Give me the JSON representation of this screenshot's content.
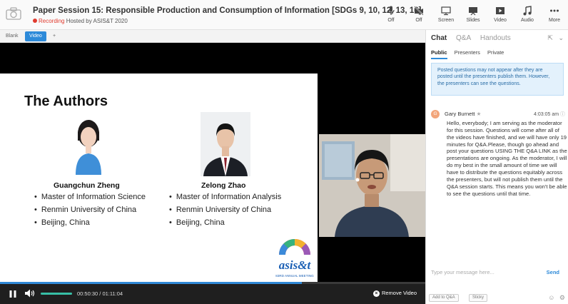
{
  "header": {
    "title": "Paper Session 15: Responsible Production and Consumption of Information [SDGs 9, 10, 12, 13, 16]",
    "recording_label": "Recording",
    "hosted_by": "Hosted by ASIS&T 2020"
  },
  "toolbar": {
    "mic_label": "Off",
    "camera_label": "Off",
    "screen_label": "Screen",
    "slides_label": "Slides",
    "video_label": "Video",
    "audio_label": "Audio",
    "more_label": "More"
  },
  "stage_tabs": {
    "blank_label": "Blank",
    "video_label": "Video",
    "add_label": "+"
  },
  "slide": {
    "title": "The Authors",
    "author1": {
      "name": "Guangchun Zheng",
      "items": [
        "Master of Information Science",
        "Renmin University of China",
        "Beijing, China"
      ]
    },
    "author2": {
      "name": "Zelong Zhao",
      "items": [
        "Master of Information Analysis",
        "Renmin University of China",
        "Beijing, China"
      ]
    },
    "logo_text": "asis&t",
    "logo_sub": "83RD ANNUAL MEETING"
  },
  "player": {
    "time": "00:50:30 / 01:11:04",
    "progress": 0.71,
    "volume": 1.0,
    "remove_label": "Remove Video"
  },
  "panel": {
    "tabs": [
      "Chat",
      "Q&A",
      "Handouts"
    ],
    "subtabs": [
      "Public",
      "Presenters",
      "Private"
    ],
    "notice": "Posted questions may not appear after they are posted until the presenters publish them. However, the presenters can see the questions.",
    "message": {
      "avatar_letter": "G",
      "author": "Gary Burnett",
      "time": "4:03:05 am",
      "body": "Hello, everybody; I am serving as the moderator for this session. Questions will come after all of the videos have finished, and we will have only 19 minutes for Q&A.Please, though go ahead and post your questions USING THE Q&A LINK as the presentations are ongoing. As the moderator, I will do my best in the small amount of time we will have to distribute the questions equitably across the presenters, but will not publish them until the Q&A session starts. This means you won't be able to see the questions until that time."
    },
    "compose_placeholder": "Type your message here...",
    "send_label": "Send",
    "add_to_qa_label": "Add to Q&A",
    "sticky_label": "Sticky"
  },
  "colors": {
    "accent": "#2d8ad9",
    "recording": "#e03b2f",
    "volume": "#37bfa6"
  }
}
